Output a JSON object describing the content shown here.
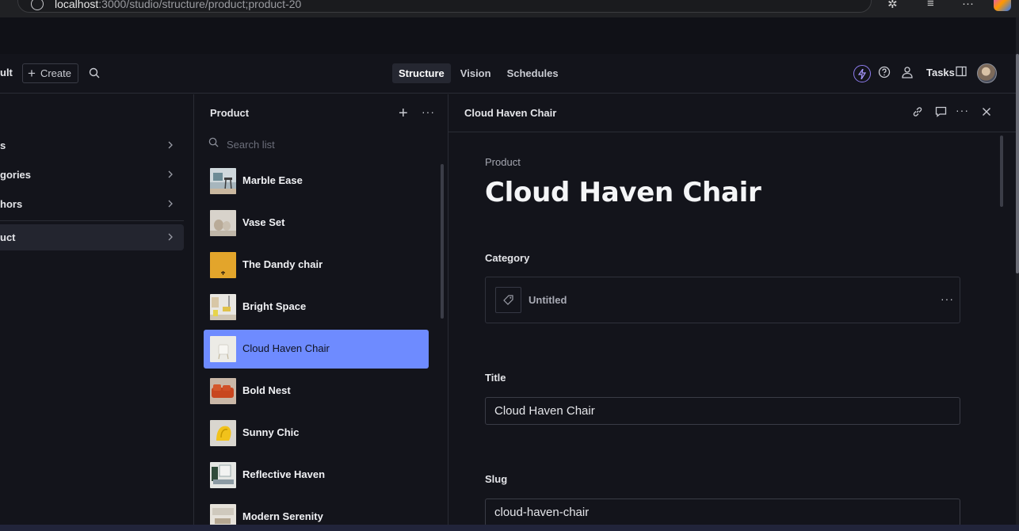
{
  "browser": {
    "url_host": "localhost",
    "url_path": ":3000/studio/structure/product;product-20"
  },
  "navbar": {
    "workspace_partial": "ult",
    "create_label": "Create",
    "tabs": [
      {
        "label": "Structure",
        "active": true
      },
      {
        "label": "Vision",
        "active": false
      },
      {
        "label": "Schedules",
        "active": false
      }
    ],
    "tasks_label": "Tasks",
    "icons": [
      "bolt-icon",
      "help-icon",
      "people-icon",
      "panel-icon"
    ]
  },
  "sidebar": {
    "items": [
      {
        "label": "s"
      },
      {
        "label": "gories"
      },
      {
        "label": "hors"
      },
      {
        "label": "uct",
        "selected": true
      }
    ]
  },
  "list": {
    "title": "Product",
    "search_placeholder": "Search list",
    "items": [
      {
        "name": "Marble Ease"
      },
      {
        "name": "Vase Set"
      },
      {
        "name": "The Dandy chair"
      },
      {
        "name": "Bright Space"
      },
      {
        "name": "Cloud Haven Chair",
        "active": true
      },
      {
        "name": "Bold Nest"
      },
      {
        "name": "Sunny Chic"
      },
      {
        "name": "Reflective Haven"
      },
      {
        "name": "Modern Serenity"
      }
    ]
  },
  "document": {
    "header_title": "Cloud Haven Chair",
    "type_label": "Product",
    "title": "Cloud Haven Chair",
    "category_label": "Category",
    "category_value": "Untitled",
    "title_label": "Title",
    "title_value": "Cloud Haven Chair",
    "slug_label": "Slug",
    "slug_value": "cloud-haven-chair"
  },
  "colors": {
    "background": "#13141b",
    "accent_selected": "#6e8bff",
    "border": "#2a2c35"
  }
}
